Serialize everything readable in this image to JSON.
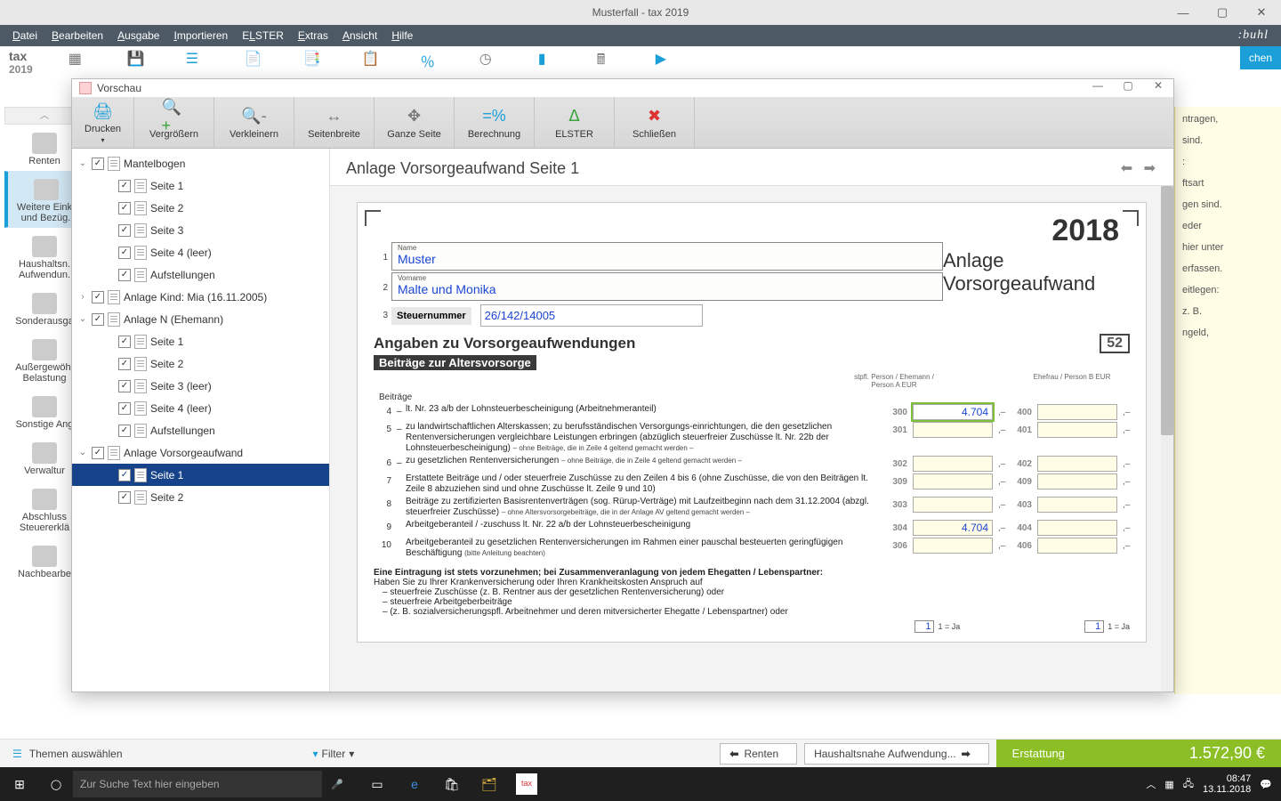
{
  "window": {
    "title": "Musterfall - tax 2019"
  },
  "menubar": [
    "Datei",
    "Bearbeiten",
    "Ausgabe",
    "Importieren",
    "ELSTER",
    "Extras",
    "Ansicht",
    "Hilfe"
  ],
  "brand": ":buhl",
  "logo": {
    "top": "tax",
    "bottom": "2019"
  },
  "top_right_btn": "chen",
  "leftnav": [
    "Renten",
    "Weitere Eink. und Bezüg.",
    "Haushaltsn. Aufwendun.",
    "Sonderausga",
    "Außergewöh. Belastung",
    "Sonstige Ang",
    "Verwaltur",
    "Abschluss Steuererklä",
    "Nachbearbe"
  ],
  "leftnav_active_index": 1,
  "right_hints": [
    "ntragen,",
    "sind.",
    ":",
    "",
    "ftsart",
    "gen sind.",
    "",
    "eder",
    "",
    "hier unter",
    "",
    "erfassen.",
    "eitlegen:",
    "z. B.",
    "",
    "ngeld,"
  ],
  "preview": {
    "title": "Vorschau",
    "toolbar": [
      "Drucken",
      "Vergrößern",
      "Verkleinern",
      "Seitenbreite",
      "Ganze Seite",
      "Berechnung",
      "ELSTER",
      "Schließen"
    ],
    "tree": [
      {
        "d": 1,
        "exp": "v",
        "label": "Mantelbogen"
      },
      {
        "d": 2,
        "label": "Seite 1"
      },
      {
        "d": 2,
        "label": "Seite 2"
      },
      {
        "d": 2,
        "label": "Seite 3"
      },
      {
        "d": 2,
        "label": "Seite 4 (leer)"
      },
      {
        "d": 2,
        "label": "Aufstellungen"
      },
      {
        "d": 1,
        "exp": ">",
        "label": "Anlage Kind: Mia (16.11.2005)"
      },
      {
        "d": 1,
        "exp": "v",
        "label": "Anlage N (Ehemann)"
      },
      {
        "d": 2,
        "label": "Seite 1"
      },
      {
        "d": 2,
        "label": "Seite 2"
      },
      {
        "d": 2,
        "label": "Seite 3 (leer)"
      },
      {
        "d": 2,
        "label": "Seite 4 (leer)"
      },
      {
        "d": 2,
        "label": "Aufstellungen"
      },
      {
        "d": 1,
        "exp": "v",
        "label": "Anlage Vorsorgeaufwand"
      },
      {
        "d": 2,
        "label": "Seite 1",
        "selected": true
      },
      {
        "d": 2,
        "label": "Seite 2"
      }
    ],
    "doc_title": "Anlage Vorsorgeaufwand Seite 1",
    "year": "2018",
    "anlage_label": "Anlage Vorsorgeaufwand",
    "name_label": "Name",
    "vorname_label": "Vorname",
    "name": "Muster",
    "vorname": "Malte und Monika",
    "steuernummer_label": "Steuernummer",
    "steuernummer": "26/142/14005",
    "section": "Angaben zu Vorsorgeaufwendungen",
    "box52": "52",
    "subsection": "Beiträge zur Altersvorsorge",
    "col_left_head": "stpfl. Person / Ehemann / Person A EUR",
    "col_right_head": "Ehefrau / Person B EUR",
    "beitraege_lbl": "Beiträge",
    "lines": [
      {
        "n": "4",
        "txt": "lt. Nr. 23 a/b der Lohnsteuerbescheinigung (Arbeitnehmeranteil)",
        "c1": "300",
        "v1": "4.704",
        "c2": "400"
      },
      {
        "n": "5",
        "txt": "zu landwirtschaftlichen Alterskassen; zu berufsständischen Versorgungs-einrichtungen, die den gesetzlichen Rentenversicherungen vergleichbare Leistungen erbringen (abzüglich steuerfreier Zuschüsse lt. Nr. 22b der Lohnsteuerbescheinigung)",
        "small": "– ohne Beiträge, die in Zeile 4 geltend gemacht werden –",
        "c1": "301",
        "c2": "401"
      },
      {
        "n": "6",
        "txt": "zu gesetzlichen Rentenversicherungen",
        "small": "– ohne Beiträge, die in Zeile 4 geltend gemacht werden –",
        "c1": "302",
        "c2": "402"
      },
      {
        "n": "7",
        "nodash": true,
        "txt": "Erstattete Beiträge und / oder steuerfreie Zuschüsse zu den Zeilen 4 bis 6 (ohne Zuschüsse, die von den Beiträgen lt. Zeile 8 abzuziehen sind und ohne Zuschüsse lt. Zeile 9 und 10)",
        "c1": "309",
        "c2": "409"
      },
      {
        "n": "8",
        "nodash": true,
        "txt": "Beiträge zu zertifizierten Basisrentenverträgen (sog. Rürup-Verträge) mit Laufzeitbeginn nach dem 31.12.2004 (abzgl. steuerfreier Zuschüsse)",
        "small": "– ohne Altersvorsorgebeiträge, die in der Anlage AV geltend gemacht werden –",
        "c1": "303",
        "c2": "403"
      },
      {
        "n": "9",
        "nodash": true,
        "txt": "Arbeitgeberanteil / -zuschuss lt. Nr. 22 a/b der Lohnsteuerbescheinigung",
        "c1": "304",
        "v1": "4.704",
        "c2": "404"
      },
      {
        "n": "10",
        "nodash": true,
        "txt": "Arbeitgeberanteil zu gesetzlichen Rentenversicherungen im Rahmen einer pauschal besteuerten geringfügigen Beschäftigung",
        "small": "(bitte Anleitung beachten)",
        "c1": "306",
        "c2": "406"
      }
    ],
    "eintragung_head": "Eine Eintragung ist stets vorzunehmen; bei Zusammenveranlagung von jedem Ehegatten / Lebenspartner:",
    "eintragung_sub": "Haben Sie zu Ihrer Krankenversicherung oder Ihren Krankheitskosten Anspruch auf",
    "eintragung_items": [
      "steuerfreie Zuschüsse (z. B. Rentner aus der gesetzlichen Rentenversicherung) oder",
      "steuerfreie Arbeitgeberbeiträge",
      "(z. B. sozialversicherungspfl. Arbeitnehmer und deren mitversicherter Ehegatte / Lebenspartner) oder"
    ],
    "ja": {
      "val": "1",
      "lbl": "1 = Ja"
    }
  },
  "statusbar": {
    "themes": "Themen auswählen",
    "filter": "Filter",
    "back": "Renten",
    "forward": "Haushaltsnahe Aufwendung...",
    "refund_label": "Erstattung",
    "refund_amount": "1.572,90 €"
  },
  "taskbar": {
    "search_placeholder": "Zur Suche Text hier eingeben",
    "time": "08:47",
    "date": "13.11.2018"
  }
}
